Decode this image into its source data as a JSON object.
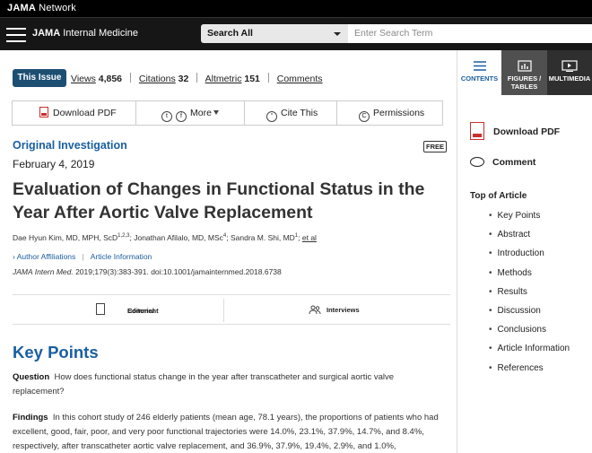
{
  "network": {
    "brand_bold": "JAMA",
    "brand_rest": " Network"
  },
  "journal": {
    "name_bold": "JAMA",
    "name_rest": " Internal Medicine"
  },
  "search": {
    "scope": "Search All",
    "placeholder": "Enter Search Term"
  },
  "right_tabs": [
    {
      "label": "CONTENTS",
      "icon": "list-icon"
    },
    {
      "label": "FIGURES / TABLES",
      "icon": "chart-icon"
    },
    {
      "label": "MULTIMEDIA",
      "icon": "play-icon"
    }
  ],
  "issue": {
    "button": "This Issue",
    "views_label": "Views",
    "views": "4,856",
    "citations_label": "Citations",
    "citations": "32",
    "altmetric_label": "Altmetric",
    "altmetric": "151",
    "comments_label": "Comments"
  },
  "toolbar": {
    "download_pdf": "Download PDF",
    "more": "More",
    "cite_this": "Cite This",
    "permissions": "Permissions"
  },
  "article": {
    "type": "Original Investigation",
    "free_badge": "FREE",
    "date": "February 4, 2019",
    "title": "Evaluation of Changes in Functional Status in the Year After Aortic Valve Replacement",
    "author1": "Dae Hyun Kim, MD, MPH, ScD",
    "author1_sup": "1,2,3",
    "author2": "; Jonathan Afilalo, MD, MSc",
    "author2_sup": "4",
    "author3": "; Sandra M. Shi, MD",
    "author3_sup": "1",
    "etal": "et al",
    "author_affiliations": "Author Affiliations",
    "article_information": "Article Information",
    "journal_abbrev": "JAMA Intern Med.",
    "citation_rest": " 2019;179(3):383-391. doi:10.1001/jamainternmed.2018.6738"
  },
  "related": {
    "editorial_line1": "Editorial",
    "editorial_line2": "Comment",
    "interviews": "Interviews"
  },
  "key_points": {
    "heading": "Key Points",
    "question_label": "Question",
    "question_text": "How does functional status change in the year after transcatheter and surgical aortic valve replacement?",
    "findings_label": "Findings",
    "findings_text": "In this cohort study of 246 elderly patients (mean age, 78.1 years), the proportions of patients who had excellent, good, fair, poor, and very poor functional trajectories were 14.0%, 23.1%, 37.9%, 14.7%, and 8.4%, respectively, after transcatheter aortic valve replacement, and 36.9%, 37.9%, 19.4%, 2.9%, and 1.0%,"
  },
  "sidebar": {
    "download_pdf": "Download PDF",
    "comment": "Comment",
    "top_of_article": "Top of Article",
    "toc": [
      "Key Points",
      "Abstract",
      "Introduction",
      "Methods",
      "Results",
      "Discussion",
      "Conclusions",
      "Article Information",
      "References"
    ]
  }
}
